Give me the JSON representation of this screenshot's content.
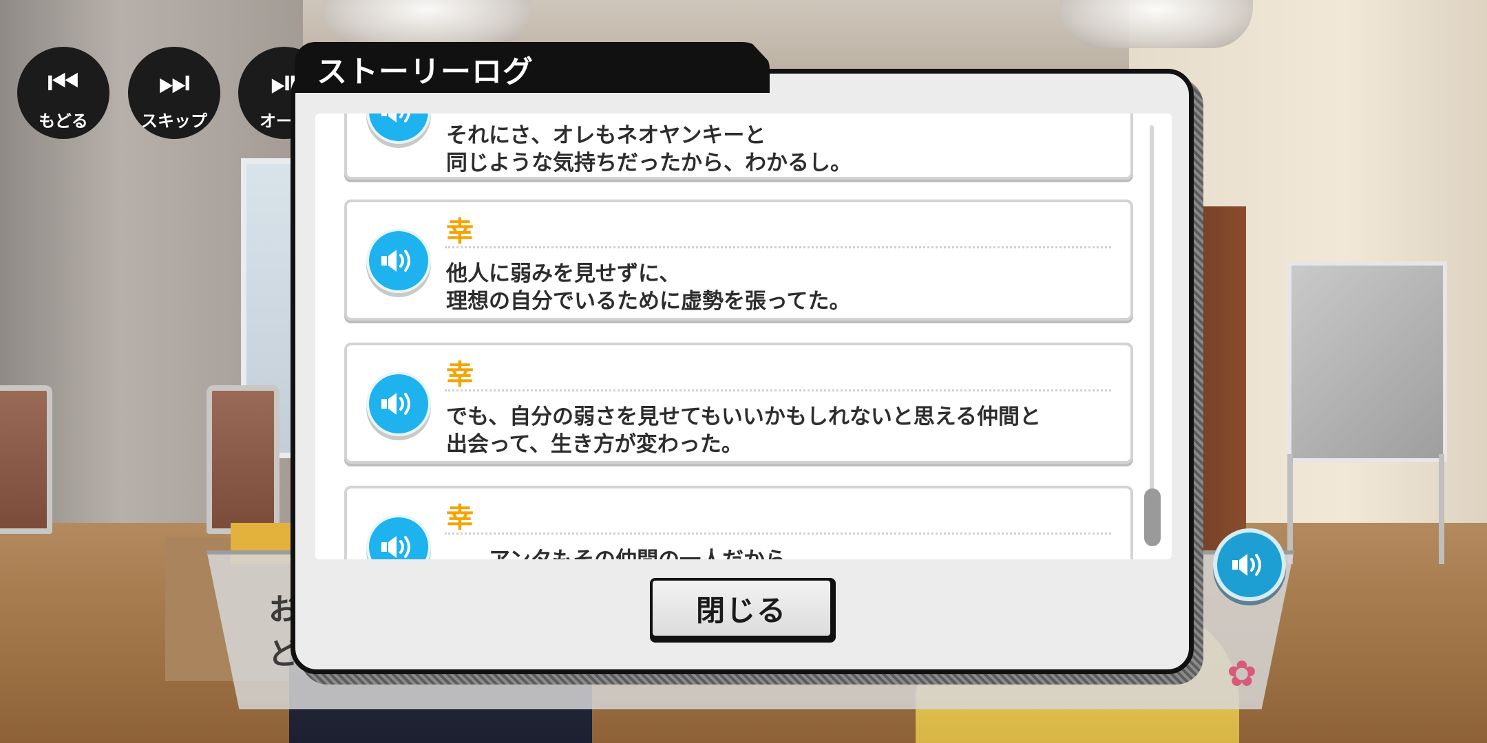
{
  "controls": [
    {
      "label": "もどる",
      "icon": "rewind-icon"
    },
    {
      "label": "スキップ",
      "icon": "skip-icon"
    },
    {
      "label": "オート",
      "icon": "auto-icon"
    }
  ],
  "dialog": {
    "title": "ストーリーログ",
    "close_label": "閉じる"
  },
  "log": [
    {
      "speaker": "",
      "lines": [
        "それにさ、オレもネオヤンキーと",
        "同じような気持ちだったから、わかるし。"
      ]
    },
    {
      "speaker": "幸",
      "lines": [
        "他人に弱みを見せずに、",
        "理想の自分でいるために虚勢を張ってた。"
      ]
    },
    {
      "speaker": "幸",
      "lines": [
        "でも、自分の弱さを見せてもいいかもしれないと思える仲間と",
        "出会って、生き方が変わった。"
      ]
    },
    {
      "speaker": "幸",
      "lines": [
        "……アンタもその仲間の一人だから。",
        ""
      ]
    }
  ],
  "message_window": {
    "text_line1": "お",
    "text_line2": "ど"
  },
  "colors": {
    "accent_blue": "#1eb2ef",
    "speaker_orange": "#f5a300",
    "dialog_bg": "#ececec",
    "frame": "#111111"
  }
}
